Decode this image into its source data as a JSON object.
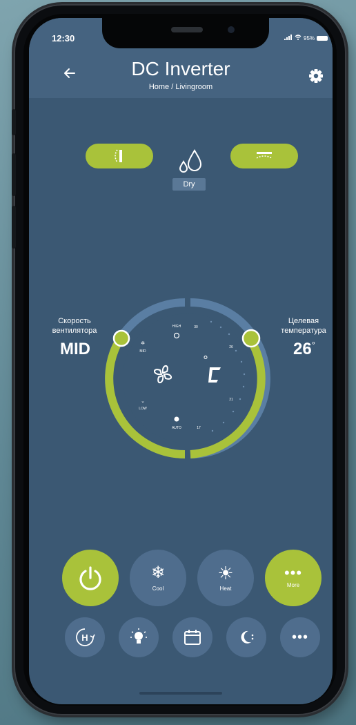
{
  "status_bar": {
    "time": "12:30",
    "right": "95%"
  },
  "header": {
    "title": "DC Inverter",
    "subtitle": "Home / Livingroom"
  },
  "mode": {
    "current": "Dry"
  },
  "fan": {
    "label": "Скорость вентилятора",
    "value": "MID"
  },
  "dial": {
    "fan_levels": [
      "HIGH",
      "MID",
      "LOW",
      "AUTO"
    ],
    "temp_ticks": [
      "30",
      "26",
      "21",
      "17"
    ],
    "unit": "°C"
  },
  "target": {
    "label": "Целевая температура",
    "value": "26",
    "degree": "°"
  },
  "main_buttons": [
    {
      "name": "power",
      "label": ""
    },
    {
      "name": "cool",
      "label": "Cool"
    },
    {
      "name": "heat",
      "label": "Heat"
    },
    {
      "name": "more",
      "label": "More"
    }
  ],
  "colors": {
    "accent": "#a9c23a",
    "screen": "#3b5873",
    "button": "#4f6d8d",
    "dial_track": "#5a7ea3"
  }
}
